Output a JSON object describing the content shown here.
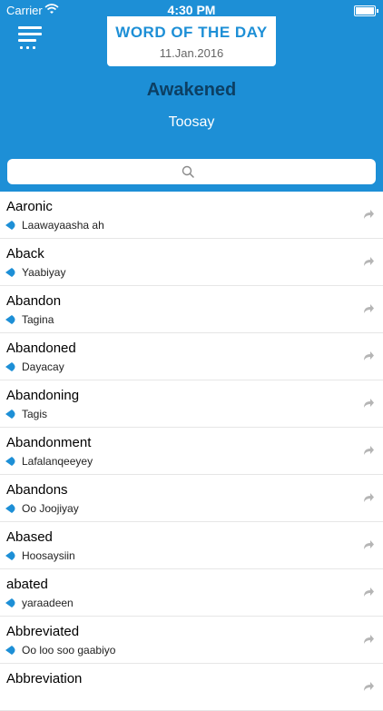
{
  "status_bar": {
    "carrier": "Carrier",
    "time": "4:30 PM"
  },
  "header": {
    "card_title": "WORD OF THE DAY",
    "card_date": "11.Jan.2016",
    "featured_word": "Awakened",
    "featured_translation": "Toosay"
  },
  "search": {
    "placeholder": ""
  },
  "colors": {
    "brand_blue": "#1d8fd6",
    "word_dark": "#0c3f63"
  },
  "list": [
    {
      "word": "Aaronic",
      "translation": "Laawayaasha ah"
    },
    {
      "word": "Aback",
      "translation": "Yaabiyay"
    },
    {
      "word": "Abandon",
      "translation": "Tagina"
    },
    {
      "word": "Abandoned",
      "translation": "Dayacay"
    },
    {
      "word": "Abandoning",
      "translation": "Tagis"
    },
    {
      "word": "Abandonment",
      "translation": "Lafalanqeeyey"
    },
    {
      "word": "Abandons",
      "translation": "Oo Joojiyay"
    },
    {
      "word": "Abased",
      "translation": "Hoosaysiin"
    },
    {
      "word": "abated",
      "translation": "yaraadeen"
    },
    {
      "word": "Abbreviated",
      "translation": "Oo loo soo gaabiyo"
    },
    {
      "word": "Abbreviation",
      "translation": ""
    }
  ],
  "icons": {
    "menu": "menu-icon",
    "search": "search-icon",
    "speaker": "speaker-icon",
    "share": "share-icon"
  }
}
